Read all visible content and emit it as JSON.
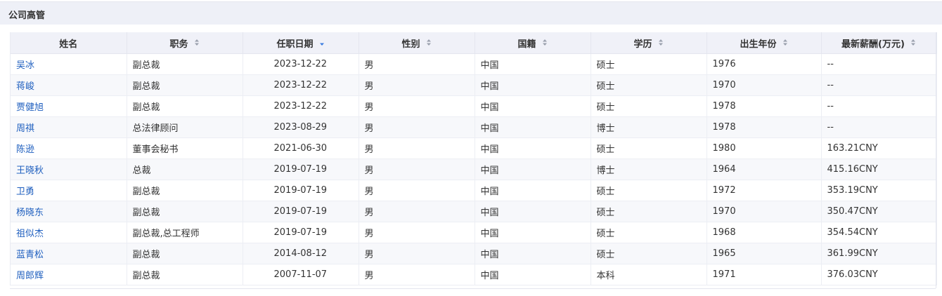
{
  "panel": {
    "title": "公司高管"
  },
  "columns": [
    {
      "label": "姓名",
      "sortable": false,
      "sort_state": "none"
    },
    {
      "label": "职务",
      "sortable": true,
      "sort_state": "none"
    },
    {
      "label": "任职日期",
      "sortable": true,
      "sort_state": "desc"
    },
    {
      "label": "性别",
      "sortable": true,
      "sort_state": "none"
    },
    {
      "label": "国籍",
      "sortable": true,
      "sort_state": "none"
    },
    {
      "label": "学历",
      "sortable": true,
      "sort_state": "none"
    },
    {
      "label": "出生年份",
      "sortable": true,
      "sort_state": "none"
    },
    {
      "label": "最新薪酬(万元)",
      "sortable": true,
      "sort_state": "none"
    }
  ],
  "rows": [
    [
      "吴冰",
      "副总裁",
      "2023-12-22",
      "男",
      "中国",
      "硕士",
      "1976",
      "--"
    ],
    [
      "蒋峻",
      "副总裁",
      "2023-12-22",
      "男",
      "中国",
      "硕士",
      "1970",
      "--"
    ],
    [
      "贾健旭",
      "副总裁",
      "2023-12-22",
      "男",
      "中国",
      "硕士",
      "1978",
      "--"
    ],
    [
      "周祺",
      "总法律顾问",
      "2023-08-29",
      "男",
      "中国",
      "博士",
      "1978",
      "--"
    ],
    [
      "陈逊",
      "董事会秘书",
      "2021-06-30",
      "男",
      "中国",
      "硕士",
      "1980",
      "163.21CNY"
    ],
    [
      "王晓秋",
      "总裁",
      "2019-07-19",
      "男",
      "中国",
      "博士",
      "1964",
      "415.16CNY"
    ],
    [
      "卫勇",
      "副总裁",
      "2019-07-19",
      "男",
      "中国",
      "硕士",
      "1972",
      "353.19CNY"
    ],
    [
      "杨晓东",
      "副总裁",
      "2019-07-19",
      "男",
      "中国",
      "硕士",
      "1970",
      "350.47CNY"
    ],
    [
      "祖似杰",
      "副总裁,总工程师",
      "2019-07-19",
      "男",
      "中国",
      "硕士",
      "1968",
      "354.54CNY"
    ],
    [
      "蓝青松",
      "副总裁",
      "2014-08-12",
      "男",
      "中国",
      "硕士",
      "1965",
      "361.99CNY"
    ],
    [
      "周郎辉",
      "副总裁",
      "2007-11-07",
      "男",
      "中国",
      "本科",
      "1971",
      "376.03CNY"
    ]
  ],
  "colors": {
    "link": "#1f5fbf",
    "sort_active": "#3a7be0",
    "sort_inactive": "#9aa0ad"
  },
  "icons": {
    "sort": "sort-arrows-icon"
  }
}
